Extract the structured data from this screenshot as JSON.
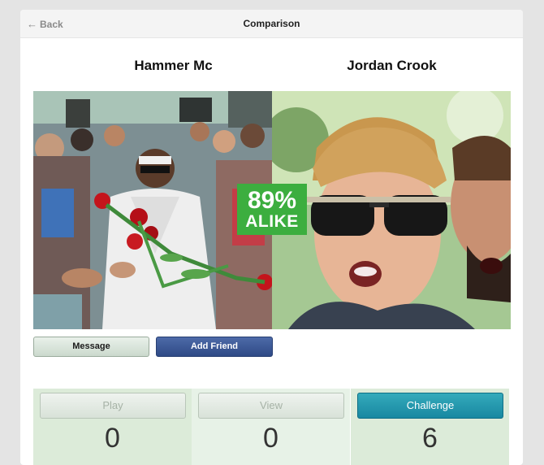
{
  "header": {
    "back_label": "Back",
    "title": "Comparison"
  },
  "people": {
    "left_name": "Hammer Mc",
    "right_name": "Jordan Crook"
  },
  "match": {
    "percent": "89%",
    "label": "ALIKE",
    "color": "#3cae3f"
  },
  "actions": {
    "message_label": "Message",
    "add_friend_label": "Add Friend"
  },
  "stats": [
    {
      "label": "Play",
      "count": "0",
      "state": "disabled"
    },
    {
      "label": "View",
      "count": "0",
      "state": "disabled"
    },
    {
      "label": "Challenge",
      "count": "6",
      "state": "active"
    }
  ]
}
